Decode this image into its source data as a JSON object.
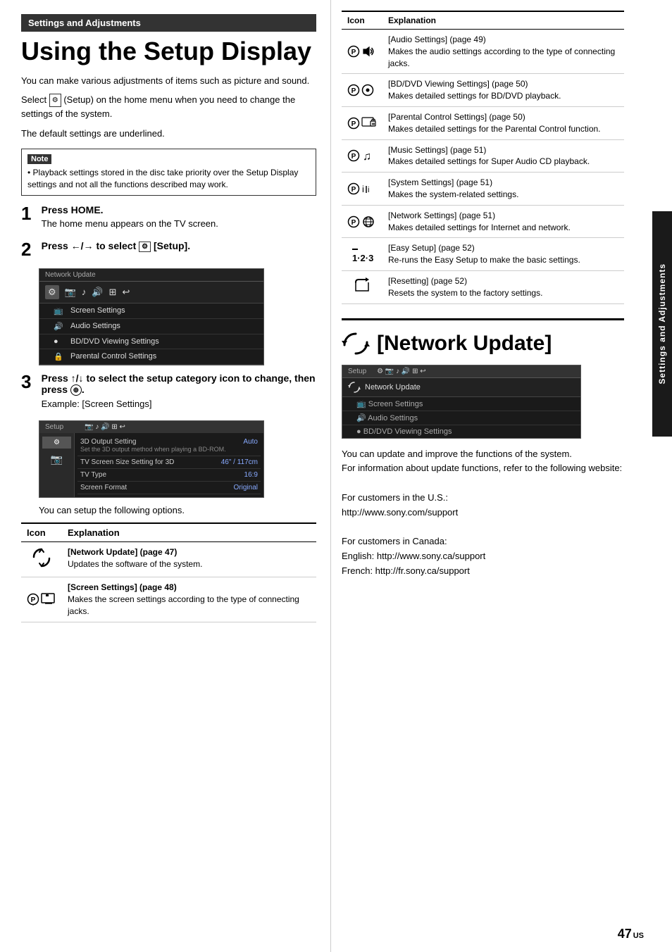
{
  "page": {
    "section_header": "Settings and Adjustments",
    "title": "Using the Setup Display",
    "intro": [
      "You can make various adjustments of items such as picture and sound.",
      "Select   (Setup) on the home menu when you need to change the settings of the system.",
      "The default settings are underlined."
    ],
    "note_label": "Note",
    "note_text": "Playback settings stored in the disc take priority over the Setup Display settings and not all the functions described may work.",
    "steps": [
      {
        "number": "1",
        "title": "Press HOME.",
        "desc": "The home menu appears on the TV screen."
      },
      {
        "number": "2",
        "title": "Press ←/→ to select   [Setup].",
        "desc": ""
      },
      {
        "number": "3",
        "title": "Press ↑/↓ to select the setup category icon to change, then press ⊕.",
        "desc": "Example: [Screen Settings]"
      }
    ],
    "you_can_setup": "You can setup the following options.",
    "lower_table": {
      "headers": [
        "Icon",
        "Explanation"
      ],
      "rows": [
        {
          "icon": "network-update",
          "title": "[Network Update] (page 47)",
          "desc": "Updates the software of the system."
        },
        {
          "icon": "screen-settings",
          "title": "[Screen Settings] (page 48)",
          "desc": "Makes the screen settings according to the type of connecting jacks."
        }
      ]
    }
  },
  "right_column": {
    "upper_table": {
      "headers": [
        "Icon",
        "Explanation"
      ],
      "rows": [
        {
          "icon": "audio-settings",
          "title": "[Audio Settings] (page 49)",
          "desc": "Makes the audio settings according to the type of connecting jacks."
        },
        {
          "icon": "bd-dvd",
          "title": "[BD/DVD Viewing Settings] (page 50)",
          "desc": "Makes detailed settings for BD/DVD playback."
        },
        {
          "icon": "parental",
          "title": "[Parental Control Settings] (page 50)",
          "desc": "Makes detailed settings for the Parental Control function."
        },
        {
          "icon": "music",
          "title": "[Music Settings] (page 51)",
          "desc": "Makes detailed settings for Super Audio CD playback."
        },
        {
          "icon": "system",
          "title": "[System Settings] (page 51)",
          "desc": "Makes the system-related settings."
        },
        {
          "icon": "network-settings",
          "title": "[Network Settings] (page 51)",
          "desc": "Makes detailed settings for Internet and network."
        },
        {
          "icon": "easy-setup",
          "title": "[Easy Setup] (page 52)",
          "desc": "Re-runs the Easy Setup to make the basic settings."
        },
        {
          "icon": "reset",
          "title": "[Resetting] (page 52)",
          "desc": "Resets the system to the factory settings."
        }
      ]
    },
    "network_section": {
      "icon": "network-update-large",
      "title": "[Network Update]",
      "body": [
        "You can update and improve the functions of the system.",
        "For information about update functions, refer to the following website:"
      ],
      "us_label": "For customers in the U.S.:",
      "us_url": "http://www.sony.com/support",
      "canada_label": "For customers in Canada:",
      "canada_english": "English: http://www.sony.ca/support",
      "canada_french": "French: http://fr.sony.ca/support"
    }
  },
  "side_tab": {
    "text": "Settings and Adjustments"
  },
  "page_number": "47",
  "page_number_suffix": "US",
  "menu_mockup": {
    "top_label": "Network Update",
    "icons": [
      "⟳",
      "📷",
      "♪",
      "🔊",
      "⊞",
      "↩"
    ],
    "rows": [
      {
        "icon": "📷",
        "label": "Screen Settings",
        "highlighted": true
      },
      {
        "icon": "🔊",
        "label": "Audio Settings",
        "highlighted": false
      },
      {
        "icon": "●",
        "label": "BD/DVD Viewing Settings",
        "highlighted": false
      },
      {
        "icon": "🔒",
        "label": "Parental Control Settings",
        "highlighted": false
      }
    ]
  },
  "settings_mockup": {
    "header": "Setup",
    "sidebar_items": [
      "⟳",
      "📷"
    ],
    "rows": [
      {
        "label": "3D Output Setting",
        "sublabel": "Set the 3D output method when playing a BD-ROM.",
        "value": "Auto"
      },
      {
        "label": "TV Screen Size Setting for 3D",
        "value": "46\" / 117cm"
      },
      {
        "label": "TV Type",
        "value": "16:9"
      },
      {
        "label": "Screen Format",
        "value": "Original"
      }
    ]
  }
}
